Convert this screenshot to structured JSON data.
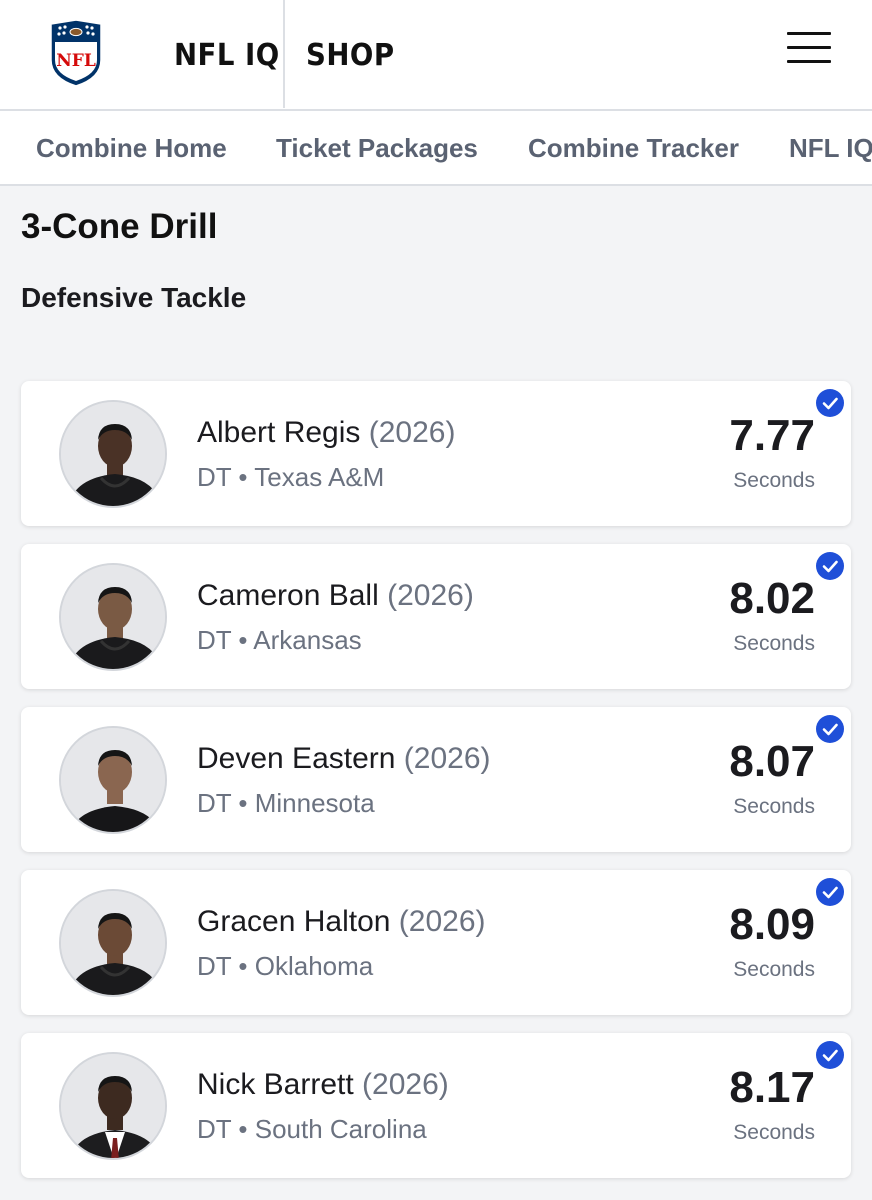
{
  "header": {
    "links": [
      "NFL IQ",
      "SHOP"
    ],
    "logo_text": "NFL"
  },
  "subnav": {
    "items": [
      "Combine Home",
      "Ticket Packages",
      "Combine Tracker",
      "NFL IQ"
    ]
  },
  "drill": {
    "title": "3-Cone Drill",
    "position": "Defensive Tackle"
  },
  "results": [
    {
      "name": "Albert Regis",
      "year": "(2026)",
      "meta": "DT • Texas A&M",
      "score": "7.77",
      "unit": "Seconds",
      "verified": true,
      "outfit": "black-hoodie"
    },
    {
      "name": "Cameron Ball",
      "year": "(2026)",
      "meta": "DT • Arkansas",
      "score": "8.02",
      "unit": "Seconds",
      "verified": true,
      "outfit": "black-hoodie"
    },
    {
      "name": "Deven Eastern",
      "year": "(2026)",
      "meta": "DT • Minnesota",
      "score": "8.07",
      "unit": "Seconds",
      "verified": true,
      "outfit": "black-tee"
    },
    {
      "name": "Gracen Halton",
      "year": "(2026)",
      "meta": "DT • Oklahoma",
      "score": "8.09",
      "unit": "Seconds",
      "verified": true,
      "outfit": "black-hoodie"
    },
    {
      "name": "Nick Barrett",
      "year": "(2026)",
      "meta": "DT • South Carolina",
      "score": "8.17",
      "unit": "Seconds",
      "verified": true,
      "outfit": "suit"
    }
  ],
  "colors": {
    "check": "#1f4fd8",
    "nfl_blue": "#013369",
    "nfl_red": "#d50a0a"
  }
}
